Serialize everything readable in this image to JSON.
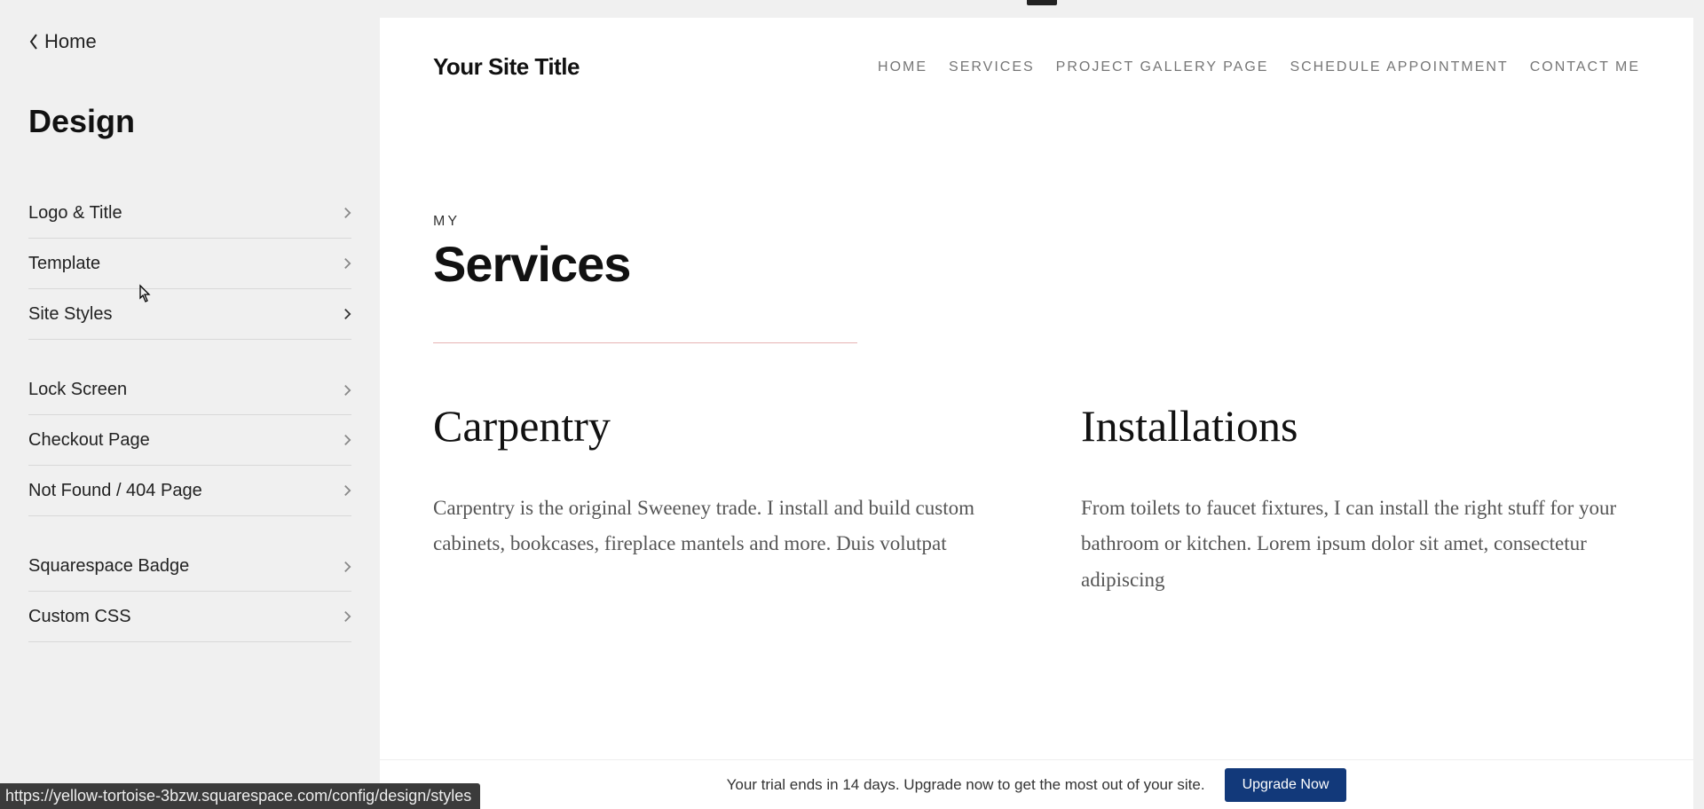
{
  "sidebar": {
    "back_label": "Home",
    "title": "Design",
    "groups": [
      {
        "items": [
          {
            "label": "Logo & Title",
            "name": "menu-logo-title"
          },
          {
            "label": "Template",
            "name": "menu-template"
          },
          {
            "label": "Site Styles",
            "name": "menu-site-styles",
            "active": true
          }
        ]
      },
      {
        "items": [
          {
            "label": "Lock Screen",
            "name": "menu-lock-screen"
          },
          {
            "label": "Checkout Page",
            "name": "menu-checkout-page"
          },
          {
            "label": "Not Found / 404 Page",
            "name": "menu-404-page"
          }
        ]
      },
      {
        "items": [
          {
            "label": "Squarespace Badge",
            "name": "menu-squarespace-badge"
          },
          {
            "label": "Custom CSS",
            "name": "menu-custom-css"
          }
        ]
      }
    ]
  },
  "status_url": "https://yellow-tortoise-3bzw.squarespace.com/config/design/styles",
  "preview": {
    "site_title": "Your Site Title",
    "nav": [
      {
        "label": "HOME",
        "name": "nav-home"
      },
      {
        "label": "SERVICES",
        "name": "nav-services"
      },
      {
        "label": "PROJECT GALLERY PAGE",
        "name": "nav-project-gallery"
      },
      {
        "label": "SCHEDULE APPOINTMENT",
        "name": "nav-schedule-appointment"
      },
      {
        "label": "CONTACT ME",
        "name": "nav-contact-me"
      }
    ],
    "eyebrow": "MY",
    "heading": "Services",
    "columns": [
      {
        "title": "Carpentry",
        "body": "Carpentry is the original Sweeney trade. I install and build custom cabinets, bookcases, fireplace mantels and more. Duis volutpat"
      },
      {
        "title": "Installations",
        "body": "From toilets to faucet fixtures, I can install the right stuff for your bathroom or kitchen. Lorem ipsum dolor sit amet, consectetur adipiscing"
      }
    ]
  },
  "trial": {
    "text": "Your trial ends in 14 days. Upgrade now to get the most out of your site.",
    "button": "Upgrade Now"
  }
}
